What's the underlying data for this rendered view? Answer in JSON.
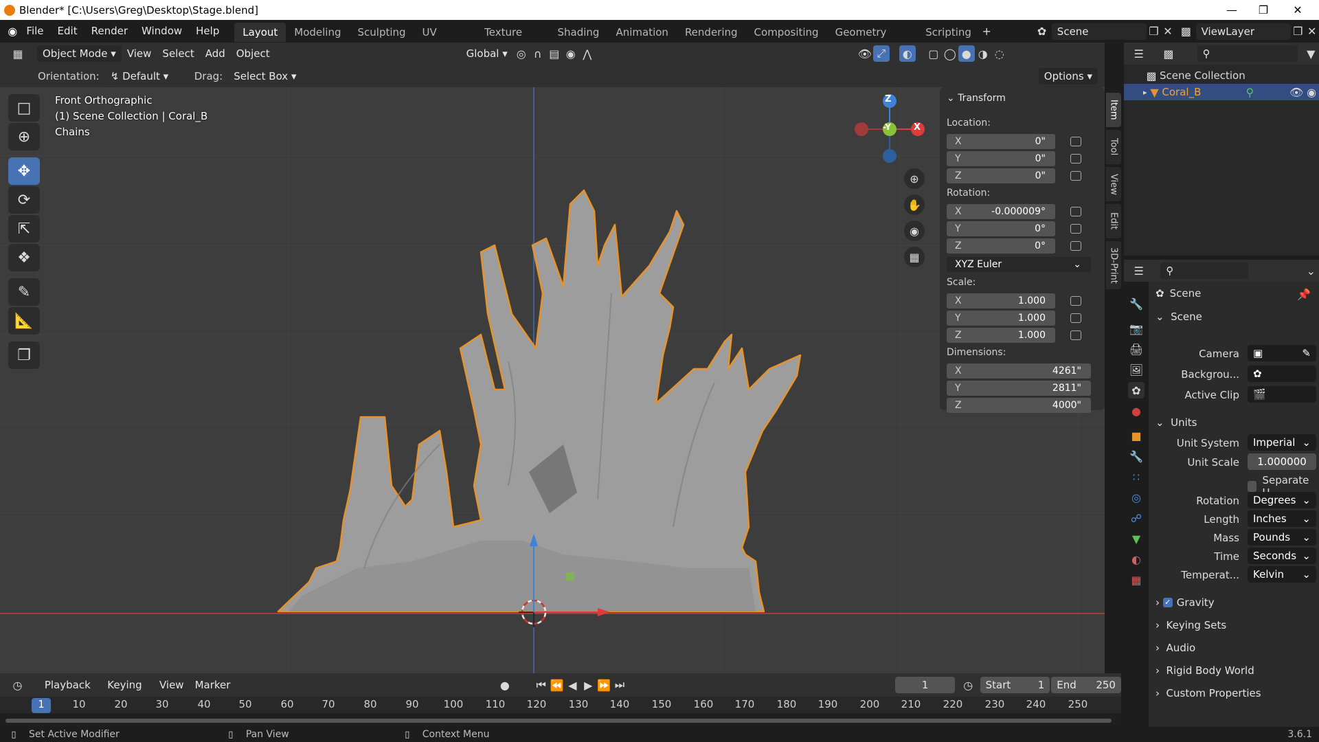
{
  "title_bar": {
    "text": "Blender* [C:\\Users\\Greg\\Desktop\\Stage.blend]"
  },
  "menus": [
    "File",
    "Edit",
    "Render",
    "Window",
    "Help"
  ],
  "workspaces": [
    "Layout",
    "Modeling",
    "Sculpting",
    "UV Editing",
    "Texture Paint",
    "Shading",
    "Animation",
    "Rendering",
    "Compositing",
    "Geometry Nodes",
    "Scripting"
  ],
  "active_workspace": "Layout",
  "scene_field": "Scene",
  "viewlayer_field": "ViewLayer",
  "view_header": {
    "mode": "Object Mode",
    "menus": [
      "View",
      "Select",
      "Add",
      "Object"
    ],
    "transform_orientation": "Global"
  },
  "tool_header": {
    "orientation_label": "Orientation:",
    "orientation": "Default",
    "drag_label": "Drag:",
    "drag": "Select Box",
    "options": "Options"
  },
  "viewport": {
    "view_name": "Front Orthographic",
    "collection_path": "(1) Scene Collection | Coral_B",
    "object_name": "Chains"
  },
  "gizmo": {
    "z": "Z",
    "y": "-Y",
    "x": "X"
  },
  "transform_panel": {
    "title": "Transform",
    "location_label": "Location:",
    "location": [
      {
        "axis": "X",
        "value": "0\""
      },
      {
        "axis": "Y",
        "value": "0\""
      },
      {
        "axis": "Z",
        "value": "0\""
      }
    ],
    "rotation_label": "Rotation:",
    "rotation": [
      {
        "axis": "X",
        "value": "-0.000009°"
      },
      {
        "axis": "Y",
        "value": "0°"
      },
      {
        "axis": "Z",
        "value": "0°"
      }
    ],
    "rotation_mode": "XYZ Euler",
    "scale_label": "Scale:",
    "scale": [
      {
        "axis": "X",
        "value": "1.000"
      },
      {
        "axis": "Y",
        "value": "1.000"
      },
      {
        "axis": "Z",
        "value": "1.000"
      }
    ],
    "dimensions_label": "Dimensions:",
    "dimensions": [
      {
        "axis": "X",
        "value": "4261\""
      },
      {
        "axis": "Y",
        "value": "2811\""
      },
      {
        "axis": "Z",
        "value": "4000\""
      }
    ]
  },
  "side_tabs": [
    "Item",
    "Tool",
    "View",
    "Edit",
    "3D-Print"
  ],
  "outliner": {
    "root": "Scene Collection",
    "item": "Coral_B"
  },
  "properties": {
    "context": "Scene",
    "scene_section": "Scene",
    "camera_label": "Camera",
    "background_label": "Backgrou...",
    "active_clip_label": "Active Clip",
    "units_section": "Units",
    "unit_system_label": "Unit System",
    "unit_system": "Imperial",
    "unit_scale_label": "Unit Scale",
    "unit_scale": "1.000000",
    "separate_units": "Separate U...",
    "rotation_label": "Rotation",
    "rotation": "Degrees",
    "length_label": "Length",
    "length": "Inches",
    "mass_label": "Mass",
    "mass": "Pounds",
    "time_label": "Time",
    "time": "Seconds",
    "temperature_label": "Temperat...",
    "temperature": "Kelvin",
    "collapsed_sections": [
      "Gravity",
      "Keying Sets",
      "Audio",
      "Rigid Body World",
      "Custom Properties"
    ]
  },
  "timeline": {
    "menus": [
      "Playback",
      "Keying",
      "View",
      "Marker"
    ],
    "current_frame": "1",
    "start_label": "Start",
    "start": "1",
    "end_label": "End",
    "end": "250",
    "ticks": [
      "1",
      "10",
      "20",
      "30",
      "40",
      "50",
      "60",
      "70",
      "80",
      "90",
      "100",
      "110",
      "120",
      "130",
      "140",
      "150",
      "160",
      "170",
      "180",
      "190",
      "200",
      "210",
      "220",
      "230",
      "240",
      "250"
    ]
  },
  "status_bar": {
    "left": "Set Active Modifier",
    "middle": "Pan View",
    "right": "Context Menu",
    "version": "3.6.1"
  },
  "colors": {
    "accent": "#4772b3",
    "selection_outline": "#e8922b",
    "x_axis": "#e13a3a",
    "y_axis": "#8ac13a",
    "z_axis": "#3f82d6"
  }
}
